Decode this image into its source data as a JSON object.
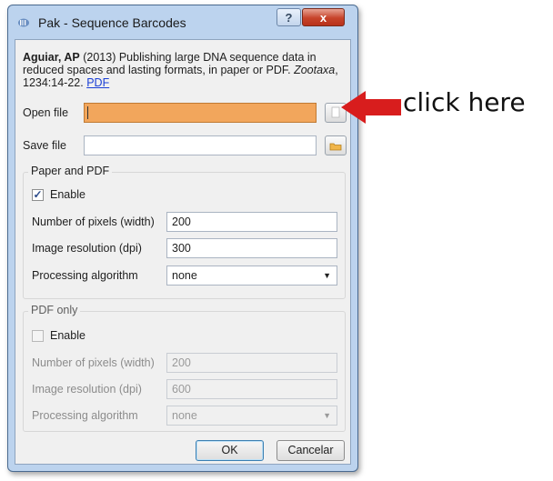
{
  "window": {
    "title": "Pak - Sequence Barcodes",
    "help_label": "?",
    "close_label": "x"
  },
  "citation": {
    "author": "Aguiar, AP",
    "text": " (2013) Publishing large DNA sequence data in reduced spaces and lasting formats, in paper or PDF. ",
    "journal": "Zootaxa",
    "pages": ", 1234:14-22. ",
    "link": "PDF"
  },
  "open_file": {
    "label": "Open file",
    "value": ""
  },
  "save_file": {
    "label": "Save file",
    "value": ""
  },
  "paper_pdf": {
    "title": "Paper and PDF",
    "enable_label": "Enable",
    "enable_checked": true,
    "pixels_label": "Number of pixels (width)",
    "pixels_value": "200",
    "resolution_label": "Image resolution (dpi)",
    "resolution_value": "300",
    "algorithm_label": "Processing algorithm",
    "algorithm_value": "none"
  },
  "pdf_only": {
    "title": "PDF only",
    "enable_label": "Enable",
    "enable_checked": false,
    "pixels_label": "Number of pixels (width)",
    "pixels_value": "200",
    "resolution_label": "Image resolution (dpi)",
    "resolution_value": "600",
    "algorithm_label": "Processing algorithm",
    "algorithm_value": "none"
  },
  "buttons": {
    "ok": "OK",
    "cancel": "Cancelar"
  },
  "annotation": {
    "text": "click here",
    "color": "#d81d1d"
  },
  "icons": {
    "app": "sequence-barcode-icon",
    "open": "file-open-icon",
    "save": "folder-save-icon",
    "checkmark": "✓",
    "dropdown": "▼"
  }
}
